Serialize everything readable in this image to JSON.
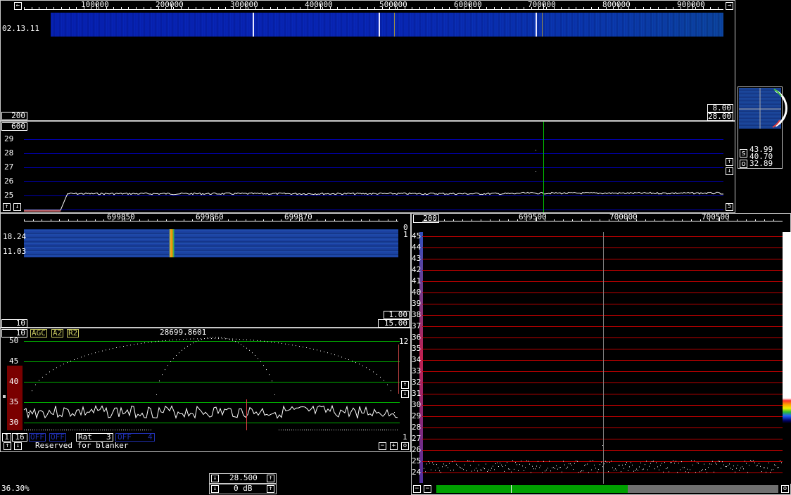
{
  "main_waterfall": {
    "freq_labels": [
      "100000",
      "200000",
      "300000",
      "400000",
      "500000",
      "600000",
      "700000",
      "800000",
      "900000"
    ],
    "time_label": "02.13.11",
    "box_left": "200",
    "box_right_top": "8.00",
    "box_right_bottom": "28.00"
  },
  "main_spectrum": {
    "box_top_left": "600",
    "y_labels": [
      "29",
      "28",
      "27",
      "26",
      "25"
    ],
    "avg_box": "5"
  },
  "polar_panel": {
    "s_label": "s",
    "s_val1": "43.99",
    "s_val2": "40.70",
    "o_label": "o",
    "o_val": "32.89"
  },
  "zoom_waterfall": {
    "freq_labels": [
      "699850",
      "699860",
      "699870"
    ],
    "row1_label": "18.24",
    "row2_label": "11.03",
    "right_top": "0",
    "right_mid": "1",
    "box_left": "10",
    "box_right_top": "1.00",
    "box_right_bottom": "15.00"
  },
  "baseband": {
    "box_left": "10",
    "agc": "AGC",
    "a2": "A2",
    "r2": "R2",
    "frequency": "28699.8601",
    "y_labels": [
      "50",
      "45",
      "40",
      "35",
      "30"
    ],
    "right_top": "12",
    "right_bottom": "1",
    "btn_1": "1",
    "btn_16": "16",
    "off1": "OFF",
    "off2": "OFF",
    "rat_label": "Rat",
    "rat_value": "3",
    "off3": "OFF",
    "off3_num": "4",
    "blanker_text": "Reserved for blanker"
  },
  "high_res": {
    "box_left": "200",
    "freq_labels": [
      "699500",
      "700000",
      "700500"
    ],
    "y_labels": [
      "45",
      "44",
      "43",
      "42",
      "41",
      "40",
      "39",
      "38",
      "37",
      "36",
      "35",
      "34",
      "33",
      "32",
      "31",
      "30",
      "29",
      "28",
      "27",
      "26",
      "25",
      "24"
    ]
  },
  "status": {
    "cpu_load": "36.30%",
    "freq_value": "28.500",
    "gain_value": "0 dB",
    "s_meter_fraction": 0.56
  },
  "colors": {
    "waterfall_blue": "#1a3f9c",
    "grid_blue": "#0000b4",
    "grid_green": "#00b000",
    "grid_red": "#c00000",
    "meter_green": "#00a000",
    "meter_gray": "#707070"
  }
}
